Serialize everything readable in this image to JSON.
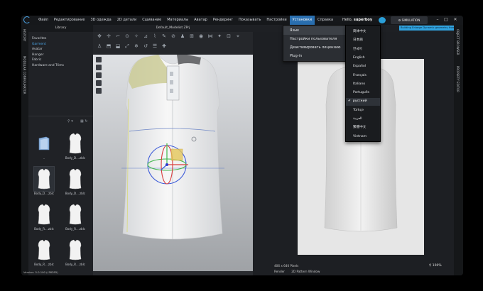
{
  "menubar": {
    "items": [
      "Файл",
      "Редактирование",
      "3D одежда",
      "2D детали",
      "Сшивание",
      "Материалы",
      "Аватар",
      "Рендеринг",
      "Показывать",
      "Настройки",
      "Установки",
      "Справка"
    ],
    "active_index": 10,
    "hello_prefix": "Hello, ",
    "user": "superboy",
    "simulation_label": "SIMULATION"
  },
  "left_strip": {
    "history": "HISTORY",
    "modular": "MODULAR CONFIGURATOR"
  },
  "library": {
    "title": "Library",
    "items": [
      "Favorites",
      "Garment",
      "Avatar",
      "Hanger",
      "Fabric",
      "Hardware and Trims"
    ],
    "selected_index": 1,
    "thumbs": [
      {
        "label": "..",
        "kind": "folder"
      },
      {
        "label": "Body_D....zblc",
        "kind": "shirt"
      },
      {
        "label": "Body_D....zblc",
        "kind": "shirt"
      },
      {
        "label": "Body_D....zblc",
        "kind": "shirt"
      },
      {
        "label": "Body_R....zblc",
        "kind": "shirt"
      },
      {
        "label": "Body_R....zblc",
        "kind": "shirt"
      },
      {
        "label": "Body_R....zblc",
        "kind": "shirt"
      },
      {
        "label": "Body_R....zblc",
        "kind": "shirt"
      }
    ],
    "selected_thumb": 2
  },
  "status": {
    "version": "Version: 5.0.100 (r38285)"
  },
  "viewport3d": {
    "title": "Default_Modelist.ZPrj"
  },
  "viewport2d": {
    "highlight": "Building Enlarge Dynamic geometry from i",
    "pixels": "406 x 640 Pixels",
    "zoom": "100%",
    "tabs": [
      "Render",
      "2D Pattern Window"
    ]
  },
  "right_strip": {
    "object_browser": "OBJECT BROWSER",
    "property_editor": "PROPERTY EDITOR"
  },
  "settings_menu": {
    "items": [
      {
        "label": "Язык",
        "submenu": true
      },
      {
        "label": "Настройки пользователя",
        "submenu": false
      },
      {
        "label": "Деактивировать лицензию",
        "submenu": false
      },
      {
        "label": "Plug-in",
        "submenu": true
      }
    ]
  },
  "language_menu": {
    "items": [
      "简体中文",
      "日本語",
      "한국어",
      "English",
      "Español",
      "Français",
      "Italiano",
      "Português",
      "русский",
      "Türkçe",
      "العربية",
      "繁體中文",
      "Vietnam"
    ],
    "selected_index": 8,
    "check": "✔"
  },
  "colors": {
    "accent": "#2a6fb0",
    "highlight": "#30a3df"
  }
}
